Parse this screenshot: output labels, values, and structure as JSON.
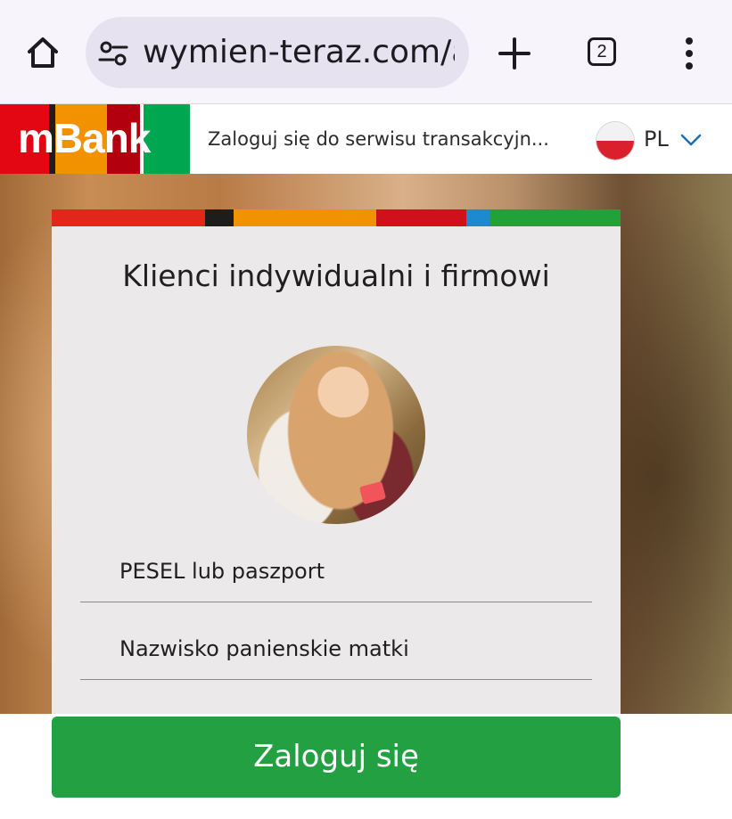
{
  "browser": {
    "url": "wymien-teraz.com/a",
    "tab_count": "2",
    "icons": [
      "home-icon",
      "site-settings-icon",
      "plus-icon",
      "tabs-icon",
      "more-vert-icon"
    ]
  },
  "header": {
    "logo_text": "mBank",
    "tagline": "Zaloguj się do serwisu transakcyjn...",
    "language": "PL",
    "logo_colors": [
      "#e30613",
      "#1d1d1b",
      "#f39200",
      "#b3000f",
      "#ffffff",
      "#00a650"
    ]
  },
  "card": {
    "title": "Klienci indywidualni i firmowi",
    "fields": [
      {
        "label": "PESEL lub paszport"
      },
      {
        "label": "Nazwisko panienskie matki"
      }
    ],
    "submit_label": "Zaloguj się",
    "accent_stripe": [
      "#e2261c",
      "#1d1d1b",
      "#f39200",
      "#d0101b",
      "#1b8ad1",
      "#22a13a"
    ]
  },
  "colors": {
    "button_green": "#23a142",
    "card_background": "#ebe9ea"
  }
}
